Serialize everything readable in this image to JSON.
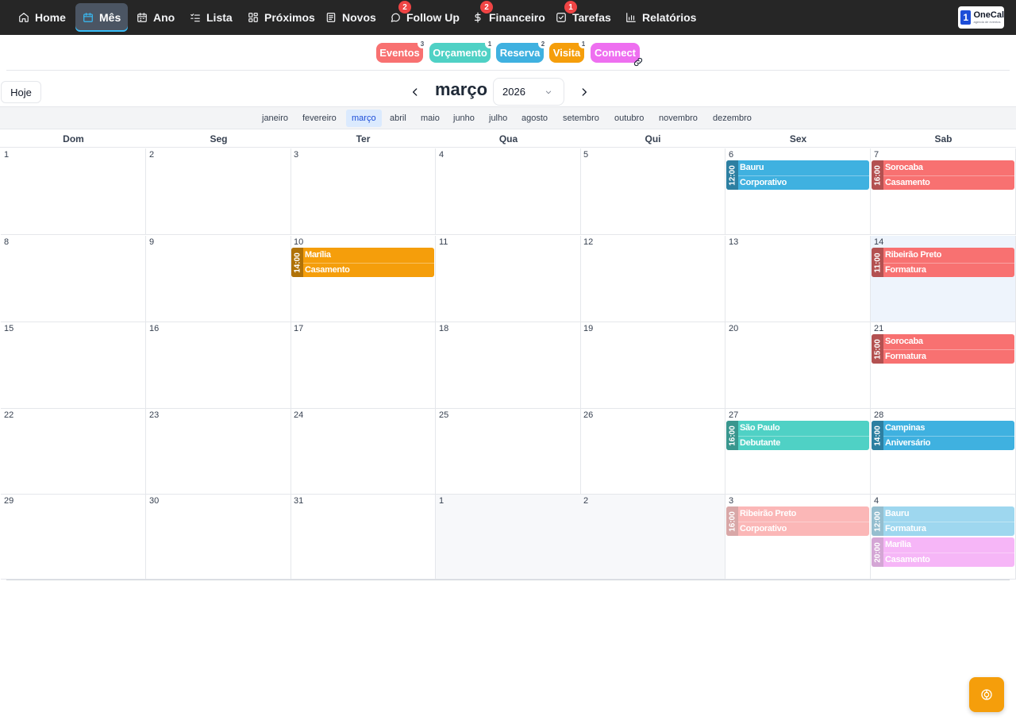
{
  "nav": {
    "items": [
      {
        "label": "Home",
        "icon": "home-icon",
        "active": false,
        "badge": ""
      },
      {
        "label": "Mês",
        "icon": "calendar-icon",
        "active": true,
        "badge": ""
      },
      {
        "label": "Ano",
        "icon": "calendar-grid-icon",
        "active": false,
        "badge": ""
      },
      {
        "label": "Lista",
        "icon": "list-icon",
        "active": false,
        "badge": ""
      },
      {
        "label": "Próximos",
        "icon": "grid-icon",
        "active": false,
        "badge": ""
      },
      {
        "label": "Novos",
        "icon": "newspaper-icon",
        "active": false,
        "badge": ""
      },
      {
        "label": "Follow Up",
        "icon": "chat-icon",
        "active": false,
        "badge": "2"
      },
      {
        "label": "Financeiro",
        "icon": "dollar-icon",
        "active": false,
        "badge": "2"
      },
      {
        "label": "Tarefas",
        "icon": "checkbox-icon",
        "active": false,
        "badge": "1"
      },
      {
        "label": "Relatórios",
        "icon": "bar-chart-icon",
        "active": false,
        "badge": ""
      }
    ],
    "logo": {
      "mark": "1",
      "name": "OneCal",
      "sub": "agenda de eventos"
    }
  },
  "filters": [
    {
      "label": "Eventos",
      "count": "3",
      "color": "#f87171"
    },
    {
      "label": "Orçamento",
      "count": "1",
      "color": "#4fd1c5"
    },
    {
      "label": "Reserva",
      "count": "2",
      "color": "#3fb1e0"
    },
    {
      "label": "Visita",
      "count": "1",
      "color": "#f59e0b"
    },
    {
      "label": "Connect",
      "count": "",
      "color": "#ee6ff0"
    }
  ],
  "header": {
    "today_label": "Hoje",
    "month": "março",
    "year": "2026"
  },
  "months": [
    "janeiro",
    "fevereiro",
    "março",
    "abril",
    "maio",
    "junho",
    "julho",
    "agosto",
    "setembro",
    "outubro",
    "novembro",
    "dezembro"
  ],
  "active_month": 2,
  "weekdays": [
    "Dom",
    "Seg",
    "Ter",
    "Qua",
    "Qui",
    "Sex",
    "Sab"
  ],
  "weeks": [
    [
      {
        "d": "1"
      },
      {
        "d": "2"
      },
      {
        "d": "3"
      },
      {
        "d": "4"
      },
      {
        "d": "5"
      },
      {
        "d": "6"
      },
      {
        "d": "7"
      }
    ],
    [
      {
        "d": "8"
      },
      {
        "d": "9"
      },
      {
        "d": "10"
      },
      {
        "d": "11"
      },
      {
        "d": "12"
      },
      {
        "d": "13"
      },
      {
        "d": "14",
        "today": true
      }
    ],
    [
      {
        "d": "15"
      },
      {
        "d": "16"
      },
      {
        "d": "17"
      },
      {
        "d": "18"
      },
      {
        "d": "19"
      },
      {
        "d": "20"
      },
      {
        "d": "21"
      }
    ],
    [
      {
        "d": "22"
      },
      {
        "d": "23"
      },
      {
        "d": "24"
      },
      {
        "d": "25"
      },
      {
        "d": "26"
      },
      {
        "d": "27"
      },
      {
        "d": "28"
      }
    ],
    [
      {
        "d": "29"
      },
      {
        "d": "30"
      },
      {
        "d": "31"
      },
      {
        "d": "1",
        "other": true
      },
      {
        "d": "2",
        "other": true
      },
      {
        "d": "3"
      },
      {
        "d": "4"
      }
    ]
  ],
  "events": [
    {
      "week": 0,
      "day": 5,
      "slot": 0,
      "time": "12:00",
      "city": "Bauru",
      "type": "Corporativo",
      "color": "#3fb1e0",
      "faded": false
    },
    {
      "week": 0,
      "day": 6,
      "slot": 0,
      "time": "16:00",
      "city": "Sorocaba",
      "type": "Casamento",
      "color": "#f87171",
      "faded": false
    },
    {
      "week": 1,
      "day": 2,
      "slot": 0,
      "time": "14:00",
      "city": "Marília",
      "type": "Casamento",
      "color": "#f59e0b",
      "faded": false
    },
    {
      "week": 1,
      "day": 6,
      "slot": 0,
      "time": "11:00",
      "city": "Ribeirão Preto",
      "type": "Formatura",
      "color": "#f87171",
      "faded": false
    },
    {
      "week": 2,
      "day": 6,
      "slot": 0,
      "time": "15:00",
      "city": "Sorocaba",
      "type": "Formatura",
      "color": "#f87171",
      "faded": false
    },
    {
      "week": 3,
      "day": 5,
      "slot": 0,
      "time": "16:00",
      "city": "São Paulo",
      "type": "Debutante",
      "color": "#4fd1c5",
      "faded": false
    },
    {
      "week": 3,
      "day": 6,
      "slot": 0,
      "time": "14:00",
      "city": "Campinas",
      "type": "Aniversário",
      "color": "#3fb1e0",
      "faded": false
    },
    {
      "week": 4,
      "day": 5,
      "slot": 0,
      "time": "16:00",
      "city": "Ribeirão Preto",
      "type": "Corporativo",
      "color": "#f87171",
      "faded": true
    },
    {
      "week": 4,
      "day": 6,
      "slot": 0,
      "time": "12:00",
      "city": "Bauru",
      "type": "Formatura",
      "color": "#3fb1e0",
      "faded": true
    },
    {
      "week": 4,
      "day": 6,
      "slot": 1,
      "time": "20:00",
      "city": "Marília",
      "type": "Casamento",
      "color": "#ee6ff0",
      "faded": true
    }
  ]
}
